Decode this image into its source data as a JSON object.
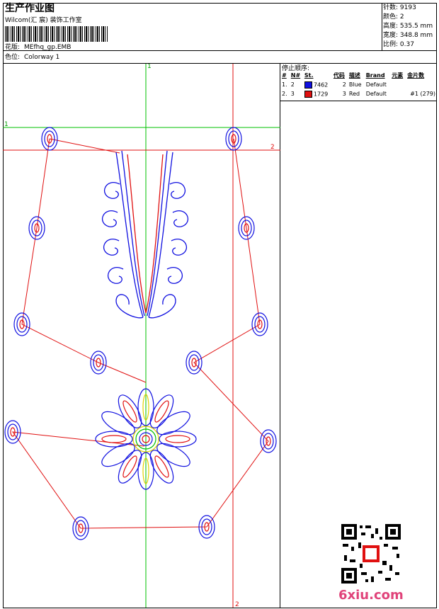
{
  "header": {
    "title": "生产作业图",
    "company": "Wilcom(汇 宸) 装饰工作室",
    "design_label": "花版:",
    "design_value": "MEfhq_gp.EMB",
    "colorway_label": "色位:",
    "colorway_value": "Colorway 1"
  },
  "stats": [
    {
      "label": "针数:",
      "value": "9193"
    },
    {
      "label": "颜色:",
      "value": "2"
    },
    {
      "label": "高度:",
      "value": "535.5 mm"
    },
    {
      "label": "宽度:",
      "value": "348.8 mm"
    },
    {
      "label": "比例:",
      "value": "0.37"
    }
  ],
  "sequence": {
    "title": "停止顺序:",
    "headers": [
      "#",
      "N#",
      "St.",
      "代码",
      "描述",
      "Brand",
      "元素",
      "金片数"
    ],
    "rows": [
      {
        "idx": "1.",
        "n": "2",
        "color": "#1010e0",
        "st": "7462",
        "code": "2",
        "desc": "Blue",
        "brand": "Default",
        "elem": "",
        "seq": ""
      },
      {
        "idx": "2.",
        "n": "3",
        "color": "#e01010",
        "st": "1729",
        "code": "3",
        "desc": "Red",
        "brand": "Default",
        "elem": "",
        "seq": "#1 (279)"
      }
    ]
  },
  "guides": {
    "v1": "1",
    "h1": "1",
    "h2": "2",
    "v2": "2"
  },
  "colors": {
    "blue": "#1010e0",
    "red": "#e01010",
    "green": "#00c000",
    "yellow": "#e0d000"
  },
  "watermark": "6xiu.com"
}
